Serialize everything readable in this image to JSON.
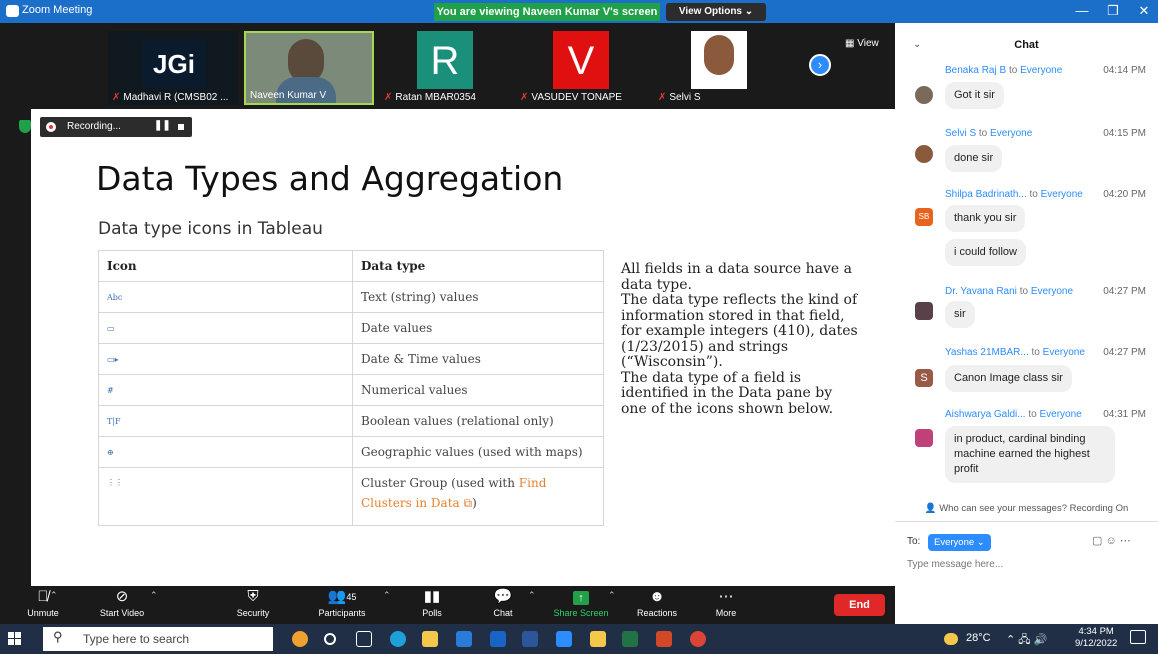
{
  "window": {
    "app_title": "Zoom Meeting",
    "viewing_banner": "You are viewing Naveen Kumar V's screen",
    "view_options": "View Options ⌄",
    "minimize": "—",
    "restore": "❐",
    "close": "✕"
  },
  "gallery": {
    "tiles": [
      {
        "name": "Madhavi R (CMSB02 ...",
        "muted": true,
        "big": "JGi"
      },
      {
        "name": "Naveen Kumar V",
        "muted": false,
        "big": ""
      },
      {
        "name": "Ratan MBAR0354",
        "muted": true,
        "big": "R"
      },
      {
        "name": "VASUDEV TONAPE",
        "muted": true,
        "big": "V"
      },
      {
        "name": "Selvi S",
        "muted": true,
        "big": ""
      }
    ],
    "view_label": "View",
    "next_glyph": "›",
    "colors": {
      "ratan_tile": "#1a8f7a",
      "vasudev_tile": "#e01010"
    }
  },
  "recording": {
    "label": "Recording...",
    "pause": "⏸"
  },
  "slide": {
    "title": "Data Types and Aggregation",
    "subtitle": "Data type icons in Tableau",
    "table": {
      "headers": [
        "Icon",
        "Data type"
      ],
      "rows": [
        {
          "icon": "Abc",
          "type": "Text (string) values"
        },
        {
          "icon": "▭",
          "type": "Date values"
        },
        {
          "icon": "▭▸",
          "type": "Date & Time values"
        },
        {
          "icon": "#",
          "type": "Numerical values"
        },
        {
          "icon": "T|F",
          "type": "Boolean values (relational only)"
        },
        {
          "icon": "⊕",
          "type": "Geographic values (used with maps)"
        }
      ],
      "cluster_row": {
        "icon": "⋮⋮",
        "prefix": "Cluster Group (used with ",
        "link": "Find Clusters in Data",
        "suffix": ")"
      }
    },
    "description": [
      "All fields in a data source have a data type.",
      "The data type reflects the kind of information stored in that field, for example integers (410), dates (1/23/2015) and strings (“Wisconsin”).",
      "The data type of a field is identified in the Data pane by one of the icons shown below."
    ]
  },
  "toolbar": {
    "unmute": "Unmute",
    "start_video": "Start Video",
    "security": "Security",
    "participants": "Participants",
    "participants_count": "45",
    "polls": "Polls",
    "chat": "Chat",
    "share_screen": "Share Screen",
    "reactions": "Reactions",
    "more": "More",
    "end": "End"
  },
  "chat": {
    "title": "Chat",
    "messages": [
      {
        "sender": "Benaka Raj B",
        "to": "to",
        "recipient": "Everyone",
        "time": "04:14 PM",
        "texts": [
          "Got it sir"
        ],
        "avatar": ""
      },
      {
        "sender": "Selvi S",
        "to": "to",
        "recipient": "Everyone",
        "time": "04:15 PM",
        "texts": [
          "done sir"
        ],
        "avatar": ""
      },
      {
        "sender": "Shilpa Badrinath...",
        "to": "to",
        "recipient": "Everyone",
        "time": "04:20 PM",
        "texts": [
          "thank you sir",
          "i could follow"
        ],
        "avatar": "SB"
      },
      {
        "sender": "Dr. Yavana Rani",
        "to": "to",
        "recipient": "Everyone",
        "time": "04:27 PM",
        "texts": [
          "sir"
        ],
        "avatar": ""
      },
      {
        "sender": "Yashas 21MBAR...",
        "to": "to",
        "recipient": "Everyone",
        "time": "04:27 PM",
        "texts": [
          "Canon Image class sir"
        ],
        "avatar": "S"
      },
      {
        "sender": "Aishwarya Galdi...",
        "to": "to",
        "recipient": "Everyone",
        "time": "04:31 PM",
        "texts": [
          "in product, cardinal binding machine earned the highest profit"
        ],
        "avatar": ""
      }
    ],
    "who_can_see": "Who can see your messages? Recording On",
    "to_label": "To:",
    "recipient_button": "Everyone ⌄",
    "input_placeholder": "Type message here..."
  },
  "taskbar": {
    "search_placeholder": "Type here to search",
    "temperature": "28°C",
    "time": "4:34 PM",
    "date": "9/12/2022"
  }
}
